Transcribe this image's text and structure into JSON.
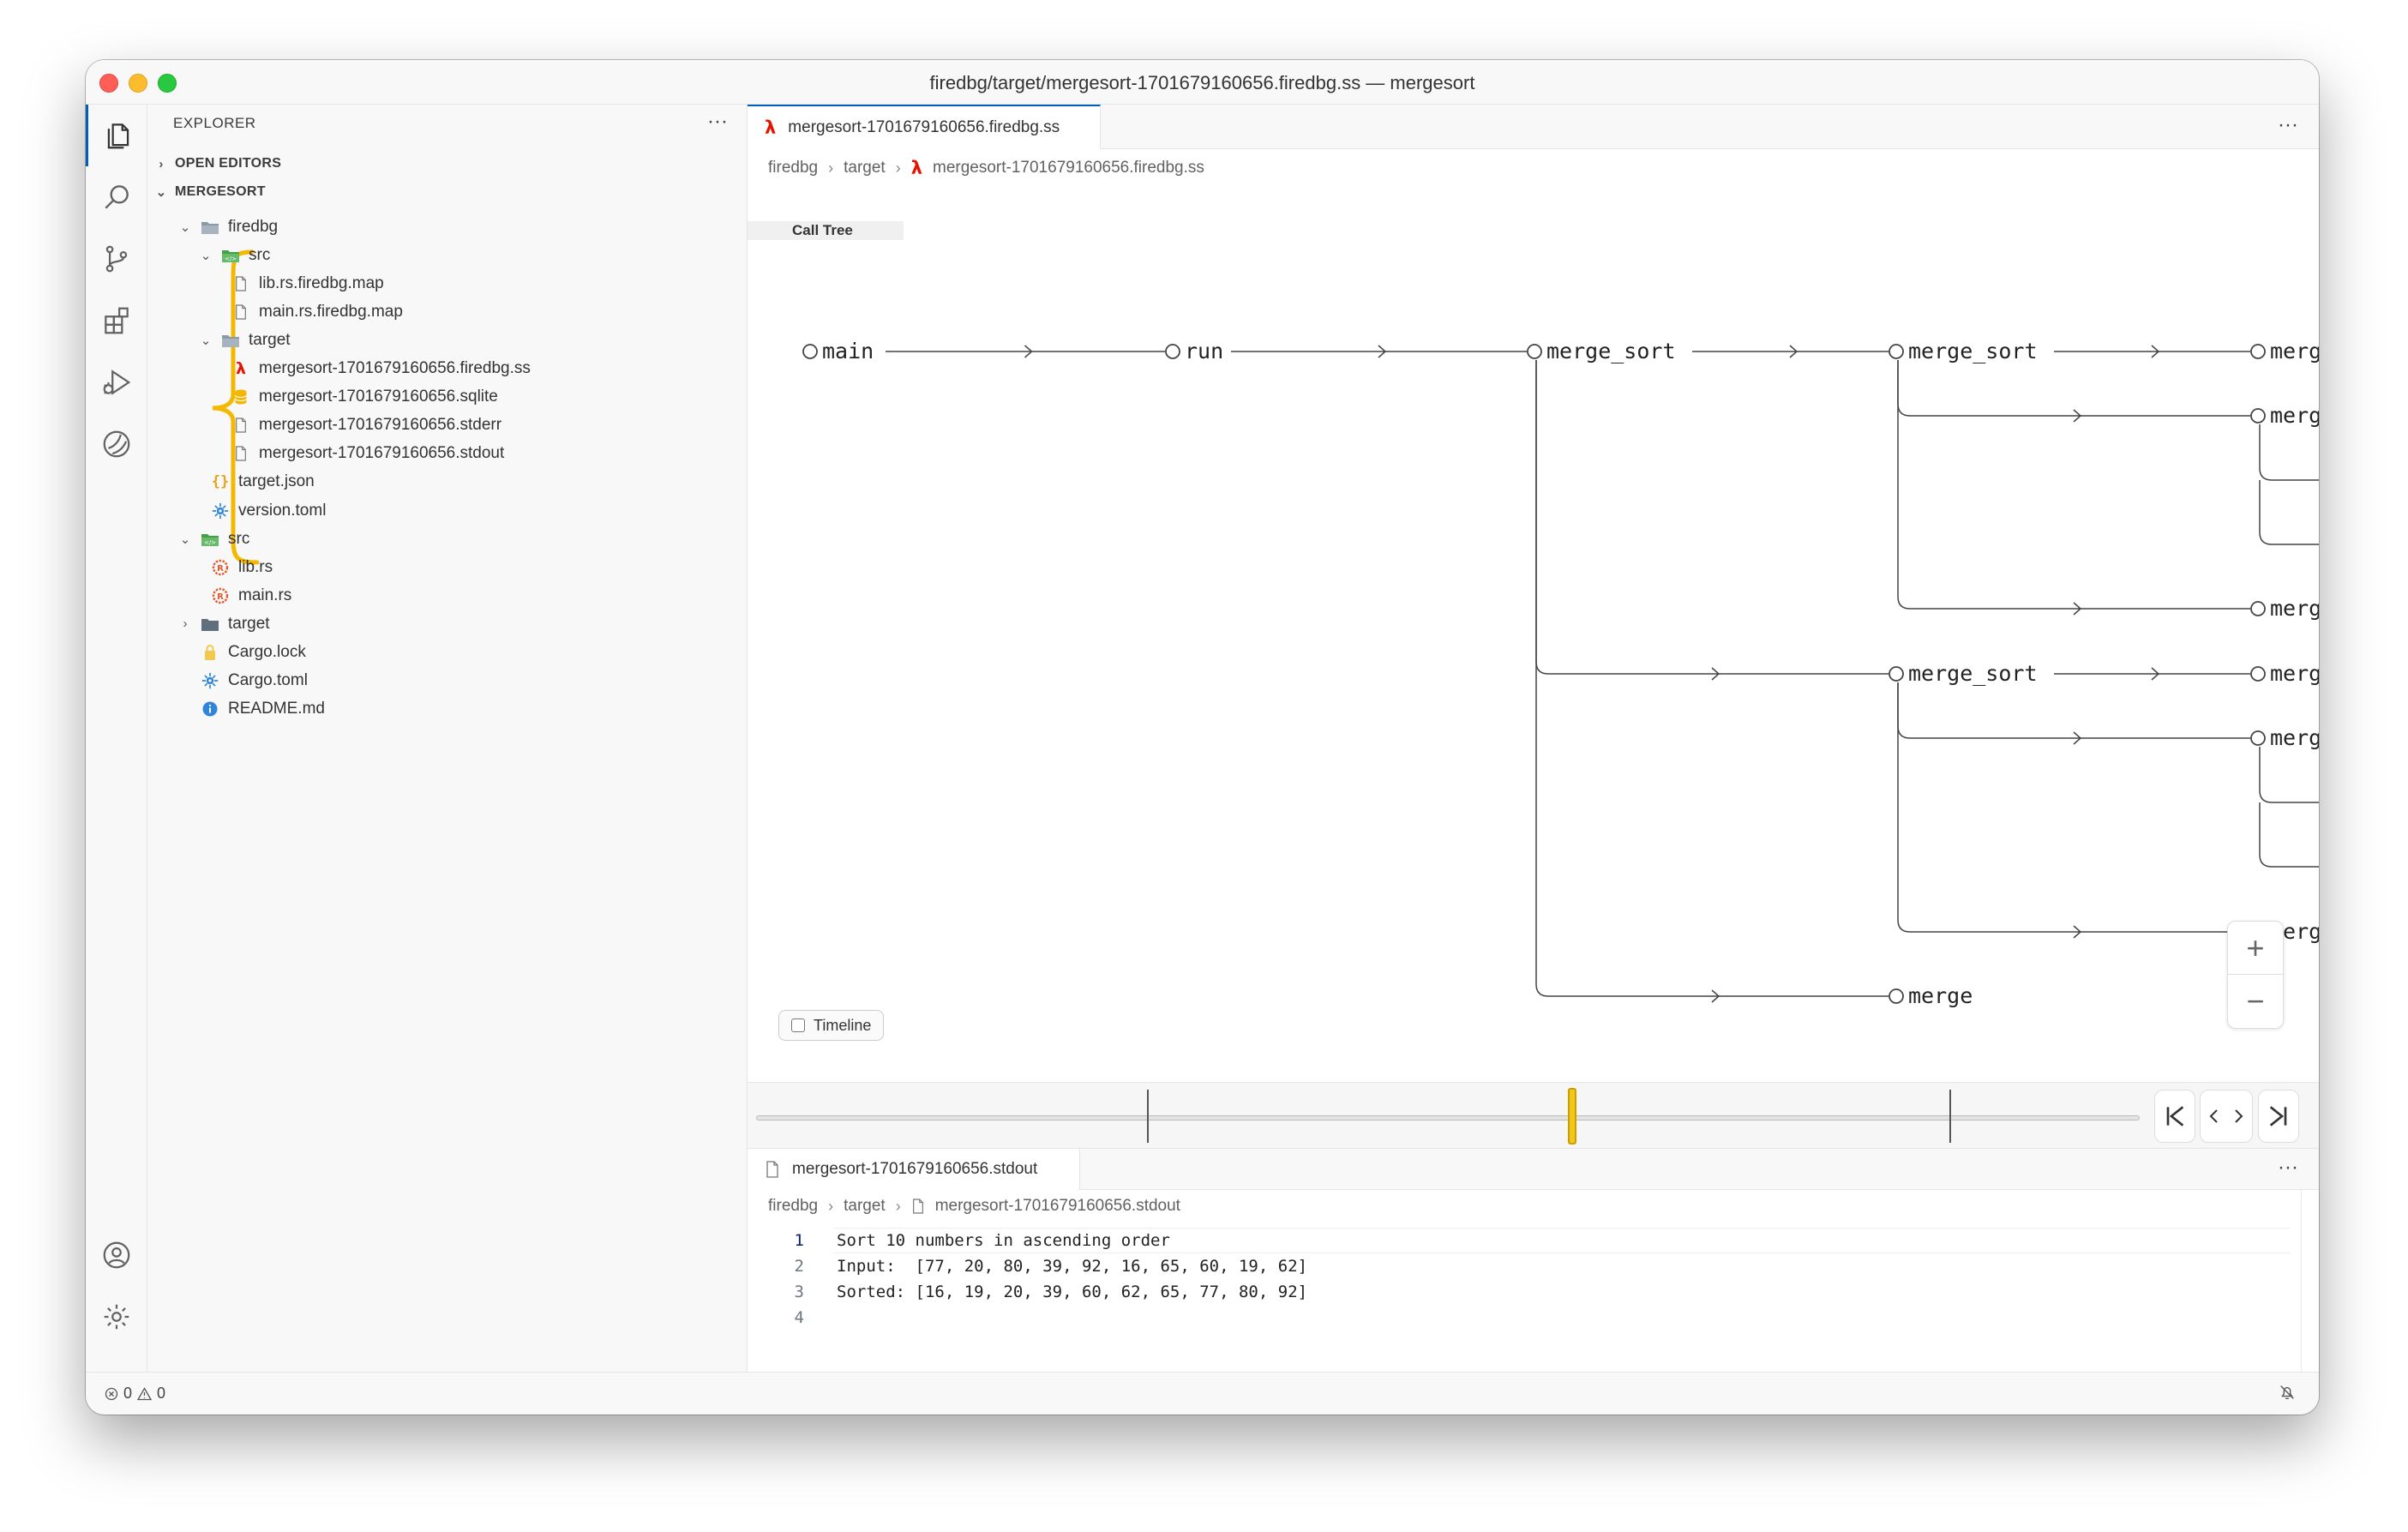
{
  "window": {
    "title": "firedbg/target/mergesort-1701679160656.firedbg.ss — mergesort"
  },
  "activity_bar": {
    "items": [
      {
        "icon": "files-icon"
      },
      {
        "icon": "search-icon"
      },
      {
        "icon": "source-control-icon"
      },
      {
        "icon": "extensions-icon"
      },
      {
        "icon": "run-debug-icon"
      },
      {
        "icon": "firedbg-icon"
      }
    ],
    "bottom": [
      {
        "icon": "account-icon"
      },
      {
        "icon": "settings-gear-icon"
      }
    ]
  },
  "sidebar": {
    "header": "EXPLORER",
    "more": "···",
    "open_editors": "OPEN EDITORS",
    "workspace": "MERGESORT",
    "tree": [
      {
        "label": "firedbg",
        "kind": "folder-open"
      },
      {
        "label": "src",
        "kind": "folder-src-open"
      },
      {
        "label": "lib.rs.firedbg.map",
        "kind": "file"
      },
      {
        "label": "main.rs.firedbg.map",
        "kind": "file"
      },
      {
        "label": "target",
        "kind": "folder-open"
      },
      {
        "label": "mergesort-1701679160656.firedbg.ss",
        "kind": "lambda"
      },
      {
        "label": "mergesort-1701679160656.sqlite",
        "kind": "database"
      },
      {
        "label": "mergesort-1701679160656.stderr",
        "kind": "file"
      },
      {
        "label": "mergesort-1701679160656.stdout",
        "kind": "file"
      },
      {
        "label": "target.json",
        "kind": "json"
      },
      {
        "label": "version.toml",
        "kind": "toml"
      },
      {
        "label": "src",
        "kind": "folder-src-open"
      },
      {
        "label": "lib.rs",
        "kind": "rust"
      },
      {
        "label": "main.rs",
        "kind": "rust"
      },
      {
        "label": "target",
        "kind": "folder-closed"
      },
      {
        "label": "Cargo.lock",
        "kind": "lock"
      },
      {
        "label": "Cargo.toml",
        "kind": "toml"
      },
      {
        "label": "README.md",
        "kind": "info"
      }
    ]
  },
  "editor": {
    "tab": {
      "label": "mergesort-1701679160656.firedbg.ss",
      "icon": "lambda"
    },
    "more": "···",
    "breadcrumb": [
      "firedbg",
      "target",
      "mergesort-1701679160656.firedbg.ss"
    ],
    "view_tab": "Call Tree",
    "call_tree": {
      "nodes": [
        "main",
        "run",
        "merge_sort",
        "merge_sort",
        "merg",
        "merg",
        "merg",
        "merge_sort",
        "merg",
        "merg",
        "merg",
        "merge"
      ]
    },
    "timeline_label": "Timeline",
    "timeline_checked": false,
    "timeline_position": 0.59,
    "zoom_in": "+",
    "zoom_out": "−"
  },
  "panel": {
    "tab": {
      "label": "mergesort-1701679160656.stdout",
      "icon": "file"
    },
    "more": "···",
    "breadcrumb": [
      "firedbg",
      "target",
      "mergesort-1701679160656.stdout"
    ],
    "lines": [
      {
        "n": "1",
        "text": "Sort 10 numbers in ascending order"
      },
      {
        "n": "2",
        "text": "Input:  [77, 20, 80, 39, 92, 16, 65, 60, 19, 62]"
      },
      {
        "n": "3",
        "text": "Sorted: [16, 19, 20, 39, 60, 62, 65, 77, 80, 92]"
      },
      {
        "n": "4",
        "text": ""
      }
    ]
  },
  "status_bar": {
    "errors": "0",
    "warnings": "0"
  },
  "colors": {
    "accent": "#005fb8",
    "lambda": "#e51400",
    "highlight": "#f5c518"
  }
}
